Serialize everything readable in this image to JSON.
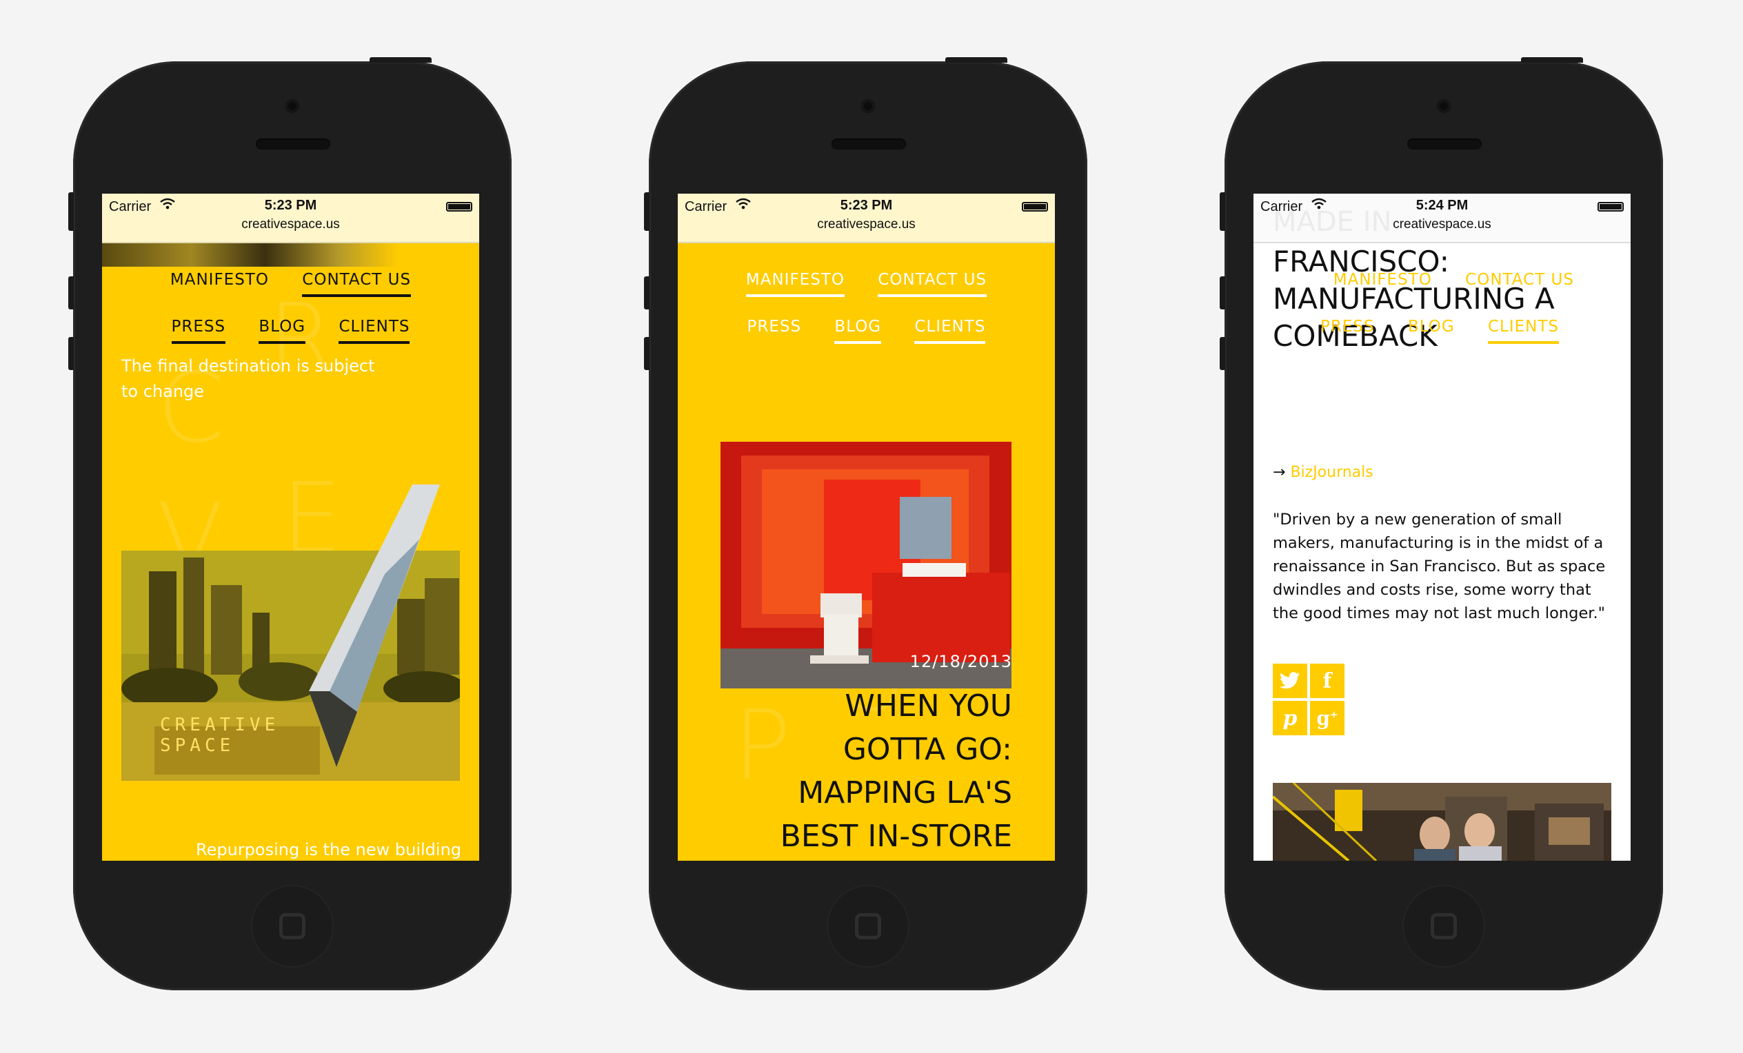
{
  "colors": {
    "accent": "#ffcc00",
    "dark": "#111111",
    "white": "#ffffff",
    "bathroom_red": "#e5261a"
  },
  "status": {
    "carrier": "Carrier",
    "url": "creativespace.us",
    "times": [
      "5:23 PM",
      "5:23 PM",
      "5:24 PM"
    ]
  },
  "nav": {
    "manifesto": "MANIFESTO",
    "contact": "CONTACT US",
    "press": "PRESS",
    "blog": "BLOG",
    "clients": "CLIENTS"
  },
  "screen1": {
    "tagline_line1": "The final destination is subject",
    "tagline_line2": "to change",
    "logo_text_line1": "CREATIVE",
    "logo_text_line2": "SPACE",
    "footer_caption": "Repurposing is the new building"
  },
  "screen2": {
    "date": "12/18/2013",
    "headline": [
      "WHEN YOU",
      "GOTTA GO:",
      "MAPPING LA'S",
      "BEST IN-STORE"
    ]
  },
  "screen3": {
    "ghost_title": "MADE IN",
    "headline": [
      "FRANCISCO:",
      "MANUFACTURING A",
      "COMEBACK"
    ],
    "source_arrow": "→",
    "source": "BizJournals",
    "quote": [
      "\"Driven by a new generation of small",
      "makers, manufacturing is in the midst of a",
      "renaissance in San Francisco. But as space",
      "dwindles and costs rise, some worry that",
      "the good times may not last much longer.\""
    ],
    "social": [
      "twitter-icon",
      "facebook-icon",
      "pinterest-icon",
      "googleplus-icon"
    ]
  }
}
